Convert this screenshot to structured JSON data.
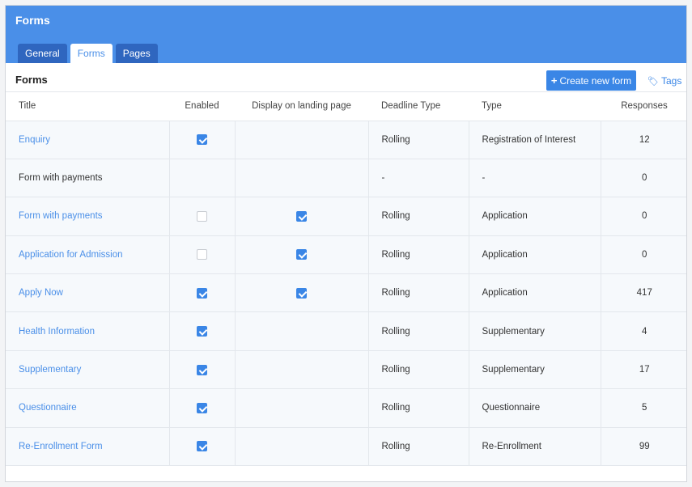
{
  "app": {
    "title": "Forms"
  },
  "tabs": [
    {
      "label": "General",
      "active": false
    },
    {
      "label": "Forms",
      "active": true
    },
    {
      "label": "Pages",
      "active": false
    }
  ],
  "section": {
    "title": "Forms",
    "create_button": "Create new form",
    "tags_link": "Tags"
  },
  "table": {
    "columns": [
      "Title",
      "Enabled",
      "Display on landing page",
      "Deadline Type",
      "Type",
      "Responses"
    ],
    "rows": [
      {
        "title": "Enquiry",
        "is_link": true,
        "enabled": true,
        "landing": null,
        "deadline": "Rolling",
        "type": "Registration of Interest",
        "responses": "12"
      },
      {
        "title": "Form with payments",
        "is_link": false,
        "enabled": null,
        "landing": null,
        "deadline": "-",
        "type": "-",
        "responses": "0"
      },
      {
        "title": "Form with payments",
        "is_link": true,
        "enabled": false,
        "landing": true,
        "deadline": "Rolling",
        "type": "Application",
        "responses": "0"
      },
      {
        "title": "Application for Admission",
        "is_link": true,
        "enabled": false,
        "landing": true,
        "deadline": "Rolling",
        "type": "Application",
        "responses": "0"
      },
      {
        "title": "Apply Now",
        "is_link": true,
        "enabled": true,
        "landing": true,
        "deadline": "Rolling",
        "type": "Application",
        "responses": "417"
      },
      {
        "title": "Health Information",
        "is_link": true,
        "enabled": true,
        "landing": null,
        "deadline": "Rolling",
        "type": "Supplementary",
        "responses": "4",
        "hover_icon": "copy-icon"
      },
      {
        "title": "Supplementary",
        "is_link": true,
        "enabled": true,
        "landing": null,
        "deadline": "Rolling",
        "type": "Supplementary",
        "responses": "17"
      },
      {
        "title": "Questionnaire",
        "is_link": true,
        "enabled": true,
        "landing": null,
        "deadline": "Rolling",
        "type": "Questionnaire",
        "responses": "5"
      },
      {
        "title": "Re-Enrollment Form",
        "is_link": true,
        "enabled": true,
        "landing": null,
        "deadline": "Rolling",
        "type": "Re-Enrollment",
        "responses": "99"
      }
    ]
  },
  "colors": {
    "header_bar": "#4a8fe8",
    "tab_dark": "#2f66bf",
    "accent": "#3a86e6",
    "hover_outline": "#9e1c22"
  }
}
